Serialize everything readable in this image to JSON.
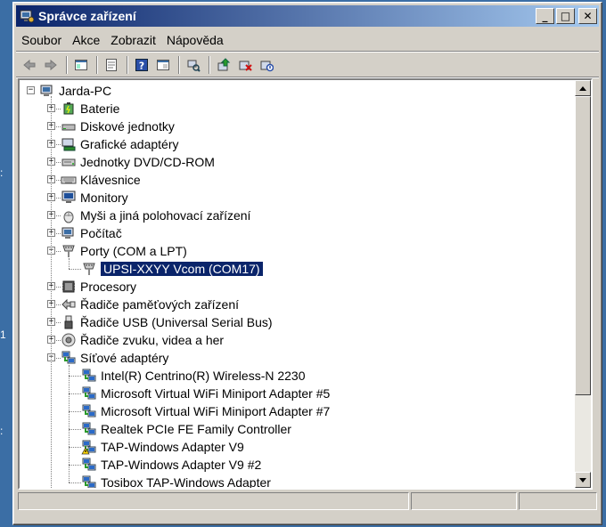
{
  "window": {
    "title": "Správce zařízení",
    "controls": {
      "minimize": "_",
      "maximize": "□",
      "close": "✕"
    }
  },
  "menu": [
    "Soubor",
    "Akce",
    "Zobrazit",
    "Nápověda"
  ],
  "toolbar": [
    "back-icon",
    "forward-icon",
    "show-hide-tree-icon",
    "properties-icon",
    "help-icon",
    "view-icon",
    "scan-hardware-icon",
    "update-driver-icon",
    "uninstall-icon",
    "disable-icon"
  ],
  "tree": {
    "root": "Jarda-PC",
    "categories": [
      {
        "label": "Baterie",
        "icon": "battery-icon",
        "expanded": false
      },
      {
        "label": "Diskové jednotky",
        "icon": "disk-drive-icon",
        "expanded": false
      },
      {
        "label": "Grafické adaptéry",
        "icon": "display-adapter-icon",
        "expanded": false
      },
      {
        "label": "Jednotky DVD/CD-ROM",
        "icon": "dvd-drive-icon",
        "expanded": false
      },
      {
        "label": "Klávesnice",
        "icon": "keyboard-icon",
        "expanded": false
      },
      {
        "label": "Monitory",
        "icon": "monitor-icon",
        "expanded": false
      },
      {
        "label": "Myši a jiná polohovací zařízení",
        "icon": "mouse-icon",
        "expanded": false
      },
      {
        "label": "Počítač",
        "icon": "computer-icon",
        "expanded": false
      },
      {
        "label": "Porty (COM a LPT)",
        "icon": "port-icon",
        "expanded": true,
        "children": [
          {
            "label": "UPSI-XXYY Vcom (COM17)",
            "icon": "port-icon",
            "selected": true
          }
        ]
      },
      {
        "label": "Procesory",
        "icon": "processor-icon",
        "expanded": false
      },
      {
        "label": "Řadiče paměťových zařízení",
        "icon": "storage-controller-icon",
        "expanded": false
      },
      {
        "label": "Řadiče USB (Universal Serial Bus)",
        "icon": "usb-icon",
        "expanded": false
      },
      {
        "label": "Řadiče zvuku, videa a her",
        "icon": "sound-icon",
        "expanded": false
      },
      {
        "label": "Síťové adaptéry",
        "icon": "network-adapter-icon",
        "expanded": true,
        "children": [
          {
            "label": "Intel(R) Centrino(R) Wireless-N 2230",
            "icon": "network-adapter-icon"
          },
          {
            "label": "Microsoft Virtual WiFi Miniport Adapter #5",
            "icon": "network-adapter-icon"
          },
          {
            "label": "Microsoft Virtual WiFi Miniport Adapter #7",
            "icon": "network-adapter-icon"
          },
          {
            "label": "Realtek PCIe FE Family Controller",
            "icon": "network-adapter-icon"
          },
          {
            "label": "TAP-Windows Adapter V9",
            "icon": "network-adapter-warning-icon"
          },
          {
            "label": "TAP-Windows Adapter V9 #2",
            "icon": "network-adapter-icon"
          },
          {
            "label": "Tosibox TAP-Windows Adapter",
            "icon": "network-adapter-icon"
          }
        ]
      }
    ]
  },
  "colors": {
    "titlebar_start": "#0a246a",
    "titlebar_end": "#a6caf0",
    "selection": "#0a246a",
    "chrome": "#d4d0c8",
    "desktop": "#3b6ea5"
  }
}
